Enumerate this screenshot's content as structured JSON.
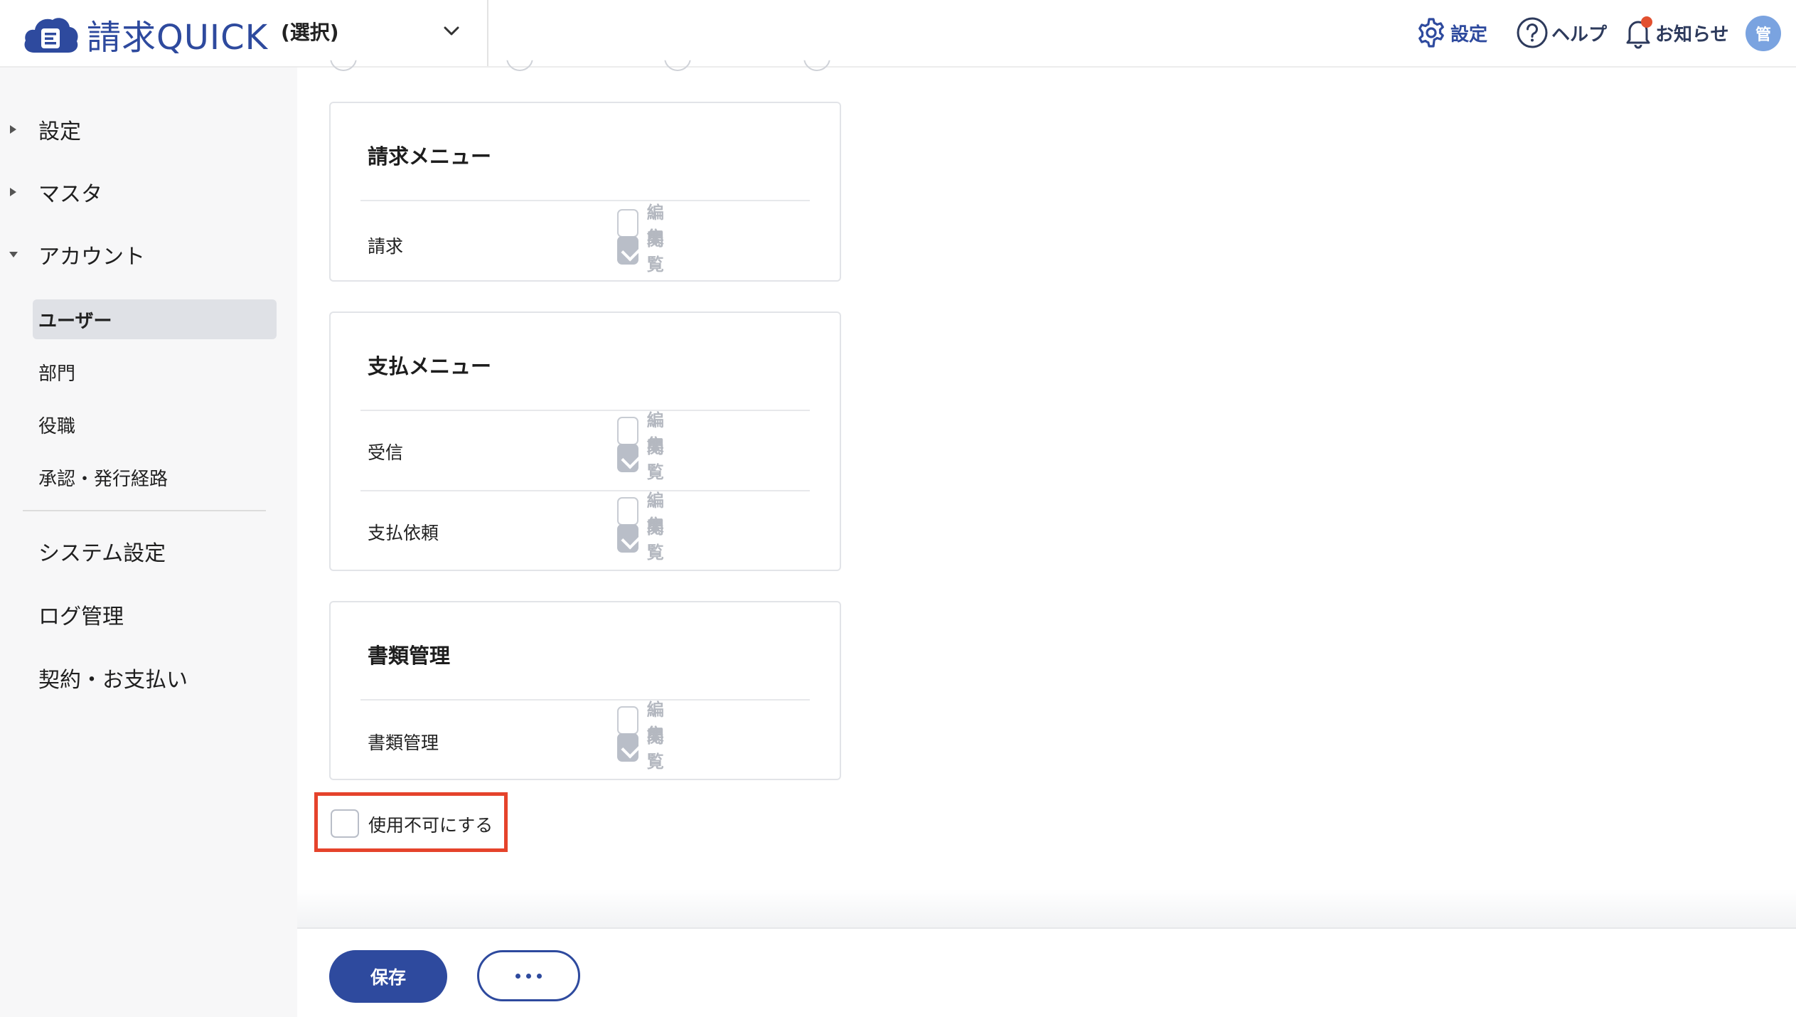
{
  "app": {
    "logo_text": "請求QUICK",
    "selector_value": "(選択)"
  },
  "header": {
    "settings_label": "設定",
    "help_label": "ヘルプ",
    "notifications_label": "お知らせ",
    "avatar_initial": "管"
  },
  "sidebar": {
    "sections": [
      {
        "label": "設定",
        "expanded": false
      },
      {
        "label": "マスタ",
        "expanded": false
      },
      {
        "label": "アカウント",
        "expanded": true
      }
    ],
    "account_items": [
      {
        "label": "ユーザー",
        "active": true
      },
      {
        "label": "部門",
        "active": false
      },
      {
        "label": "役職",
        "active": false
      },
      {
        "label": "承認・発行経路",
        "active": false
      }
    ],
    "bottom_items": [
      {
        "label": "システム設定"
      },
      {
        "label": "ログ管理"
      },
      {
        "label": "契約・お支払い"
      }
    ]
  },
  "permission_cards": [
    {
      "title": "請求メニュー",
      "rows": [
        {
          "name": "請求",
          "edit_label": "編集",
          "edit_checked": false,
          "view_label": "閲覧",
          "view_checked": true
        }
      ]
    },
    {
      "title": "支払メニュー",
      "rows": [
        {
          "name": "受信",
          "edit_label": "編集",
          "edit_checked": false,
          "view_label": "閲覧",
          "view_checked": true
        },
        {
          "name": "支払依頼",
          "edit_label": "編集",
          "edit_checked": false,
          "view_label": "閲覧",
          "view_checked": true
        }
      ]
    },
    {
      "title": "書類管理",
      "rows": [
        {
          "name": "書類管理",
          "edit_label": "編集",
          "edit_checked": false,
          "view_label": "閲覧",
          "view_checked": true
        }
      ]
    }
  ],
  "disable_option": {
    "label": "使用不可にする",
    "checked": false
  },
  "footer": {
    "save_label": "保存"
  },
  "colors": {
    "brand": "#2e4a9e",
    "highlight_border": "#e5432b",
    "notification_dot": "#e2502f"
  }
}
